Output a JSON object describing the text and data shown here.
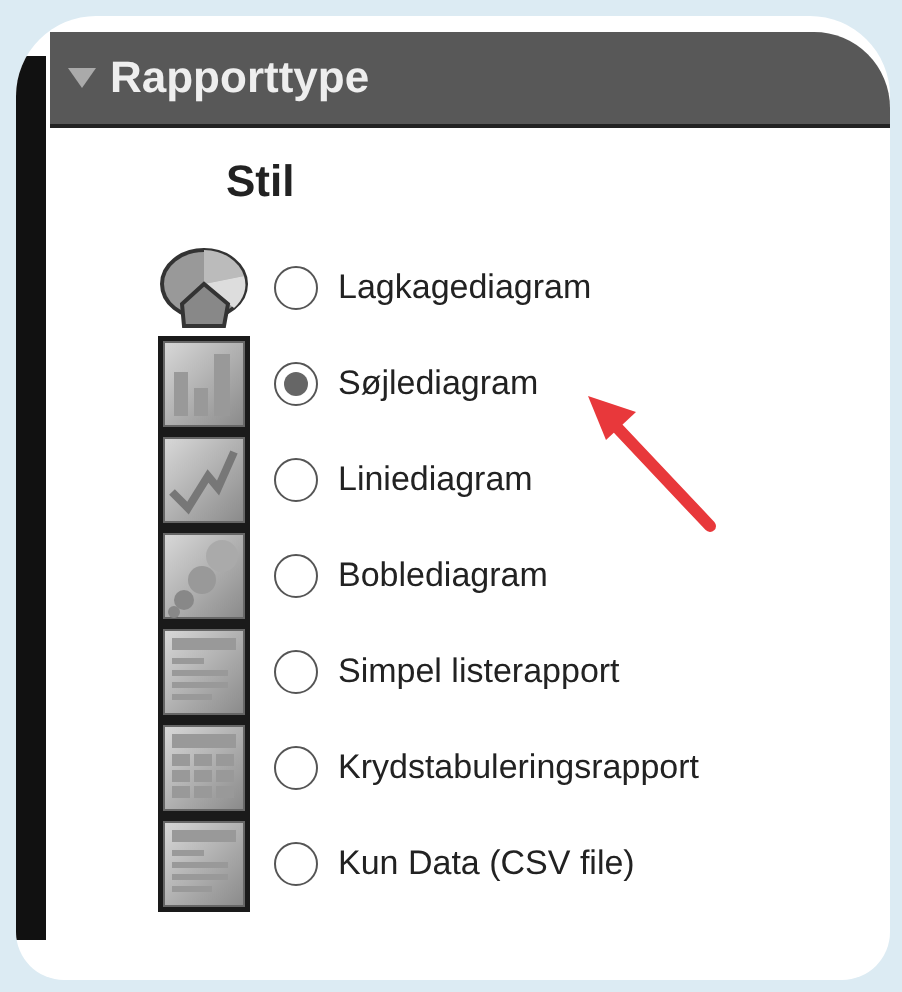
{
  "panel": {
    "title": "Rapporttype",
    "expanded": true
  },
  "section": {
    "title": "Stil"
  },
  "options": [
    {
      "kind": "pie",
      "label": "Lagkagediagram",
      "selected": false
    },
    {
      "kind": "bar",
      "label": "Søjlediagram",
      "selected": true
    },
    {
      "kind": "line",
      "label": "Liniediagram",
      "selected": false
    },
    {
      "kind": "bubble",
      "label": "Boblediagram",
      "selected": false
    },
    {
      "kind": "list",
      "label": "Simpel listerapport",
      "selected": false
    },
    {
      "kind": "crosstab",
      "label": "Krydstabuleringsrapport",
      "selected": false
    },
    {
      "kind": "list",
      "label": "Kun Data (CSV file)",
      "selected": false
    }
  ]
}
